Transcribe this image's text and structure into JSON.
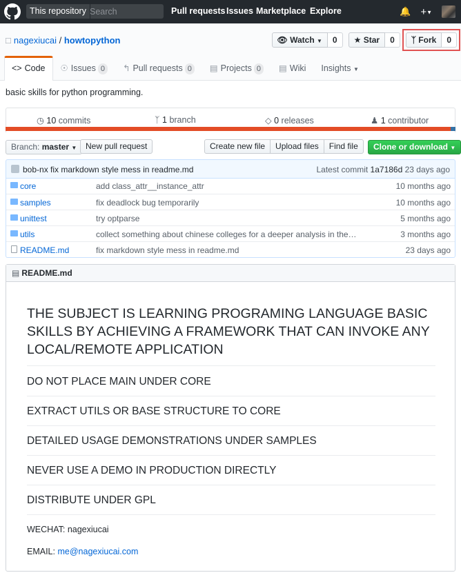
{
  "header": {
    "search_scope": "This repository",
    "search_placeholder": "Search",
    "nav": [
      "Pull requests",
      "Issues",
      "Marketplace",
      "Explore"
    ],
    "icons": [
      "github-logo-icon",
      "bell-icon",
      "plus-icon",
      "avatar"
    ]
  },
  "repo": {
    "owner": "nagexiucai",
    "name": "howtopython",
    "watch_label": "Watch",
    "watch_count": "0",
    "star_label": "Star",
    "star_count": "0",
    "fork_label": "Fork",
    "fork_count": "0"
  },
  "tabs": [
    {
      "label": "Code",
      "icon": "code-icon"
    },
    {
      "label": "Issues",
      "badge": "0",
      "icon": "issue-icon"
    },
    {
      "label": "Pull requests",
      "badge": "0",
      "icon": "pr-icon"
    },
    {
      "label": "Projects",
      "badge": "0",
      "icon": "project-icon"
    },
    {
      "label": "Wiki",
      "icon": "wiki-icon"
    },
    {
      "label": "Insights",
      "icon": "caret-down-icon"
    }
  ],
  "description": "basic skills for python programming.",
  "summary": {
    "commits_num": "10",
    "commits_label": "commits",
    "branch_num": "1",
    "branch_label": "branch",
    "releases_num": "0",
    "releases_label": "releases",
    "contributor_num": "1",
    "contributor_label": "contributor"
  },
  "toolbar": {
    "branch_label": "Branch:",
    "branch_value": "master",
    "new_pr": "New pull request",
    "create_file": "Create new file",
    "upload_files": "Upload files",
    "find_file": "Find file",
    "clone": "Clone or download"
  },
  "commit": {
    "author": "bob-nx",
    "message": "fix markdown style mess in readme.md",
    "latest_label": "Latest commit",
    "sha": "1a7186d",
    "age": "23 days ago"
  },
  "files": [
    {
      "name": "core",
      "type": "dir",
      "message": "add class_attr__instance_attr",
      "age": "10 months ago"
    },
    {
      "name": "samples",
      "type": "dir",
      "message": "fix deadlock bug temporarily",
      "age": "10 months ago"
    },
    {
      "name": "unittest",
      "type": "dir",
      "message": "try optparse",
      "age": "5 months ago"
    },
    {
      "name": "utils",
      "type": "dir",
      "message": "collect something about chinese colleges for a deeper analysis in the…",
      "age": "3 months ago"
    },
    {
      "name": "README.md",
      "type": "file",
      "message": "fix markdown style mess in readme.md",
      "age": "23 days ago"
    }
  ],
  "readme": {
    "filename": "README.md",
    "h1": "THE SUBJECT IS LEARNING PROGRAMING LANGUAGE BASIC SKILLS BY ACHIEVING A FRAMEWORK THAT CAN INVOKE ANY LOCAL/REMOTE APPLICATION",
    "h2": [
      "DO NOT PLACE MAIN UNDER CORE",
      "EXTRACT UTILS OR BASE STRUCTURE TO CORE",
      "DETAILED USAGE DEMONSTRATIONS UNDER SAMPLES",
      "NEVER USE A DEMO IN PRODUCTION DIRECTLY",
      "DISTRIBUTE UNDER GPL"
    ],
    "wechat_label": "WECHAT:",
    "wechat_value": "nagexiucai",
    "email_label": "EMAIL:",
    "email_value": "me@nagexiucai.com"
  },
  "colors": {
    "header_bg": "#24292e",
    "link": "#0366d6",
    "tab_accent": "#e36209",
    "python_lang": "#e34c26",
    "clone_green": "#28a745",
    "fork_highlight": "#e05252"
  }
}
